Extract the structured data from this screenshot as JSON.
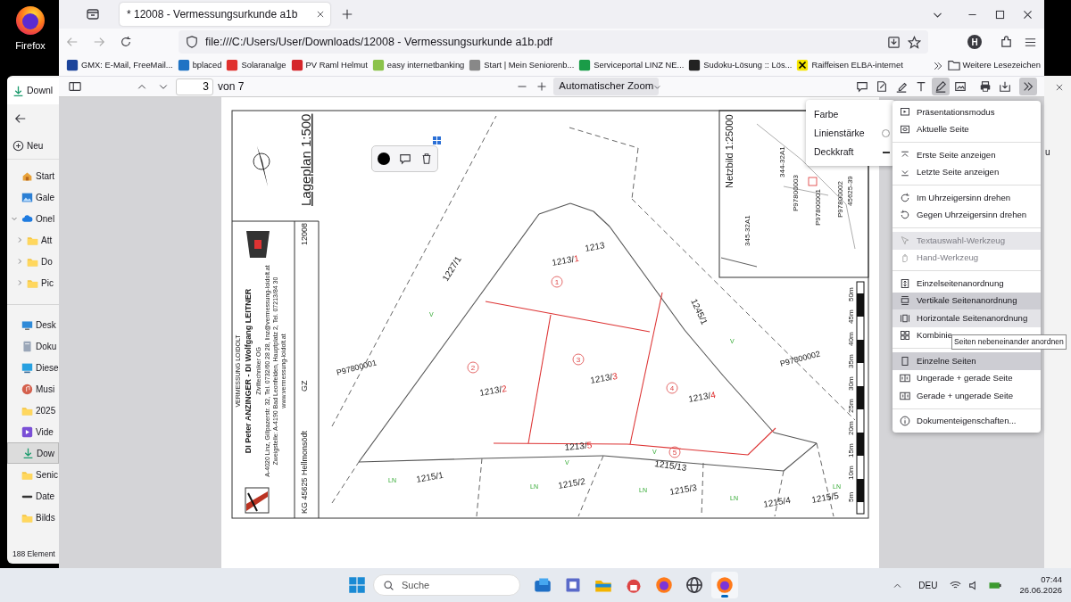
{
  "desktop": {
    "icons": [
      {
        "label": "Firefox"
      }
    ]
  },
  "explorer": {
    "tab": "Downl",
    "new_button": "Neu",
    "nav": [
      {
        "label": "Start",
        "kind": "home",
        "selected": false
      },
      {
        "label": "Gale",
        "kind": "gallery",
        "selected": false
      },
      {
        "label": "Onel",
        "kind": "cloud",
        "selected": false,
        "expanded": true,
        "children": [
          {
            "label": "Att",
            "kind": "folder",
            "selected": false,
            "expanded": false
          },
          {
            "label": "Do",
            "kind": "folder",
            "selected": false,
            "expanded": false
          },
          {
            "label": "Pic",
            "kind": "folder",
            "selected": false,
            "expanded": false
          }
        ]
      },
      {
        "label": "Desk",
        "kind": "desktop",
        "selected": false,
        "group_start": true
      },
      {
        "label": "Doku",
        "kind": "document",
        "selected": false
      },
      {
        "label": "Diese",
        "kind": "pc",
        "selected": false
      },
      {
        "label": "Musi",
        "kind": "music",
        "selected": false
      },
      {
        "label": "2025",
        "kind": "folder",
        "selected": false
      },
      {
        "label": "Vide",
        "kind": "video",
        "selected": false
      },
      {
        "label": "Dow",
        "kind": "download",
        "selected": true
      },
      {
        "label": "Senic",
        "kind": "folder",
        "selected": false
      },
      {
        "label": "Date",
        "kind": "drive",
        "selected": false
      },
      {
        "label": "Bilds",
        "kind": "folder",
        "selected": false
      }
    ],
    "status": "188 Element"
  },
  "firefox": {
    "tab": {
      "title": "* 12008 - Vermessungsurkunde a1b"
    },
    "url": "file:///C:/Users/User/Downloads/12008 - Vermessungsurkunde a1b.pdf",
    "account_initial": "H",
    "bookmarks": [
      {
        "label": "GMX: E-Mail, FreeMail...",
        "kind": "gmx"
      },
      {
        "label": "bplaced",
        "kind": "bplaced"
      },
      {
        "label": "Solaranalge",
        "kind": "solar"
      },
      {
        "label": "PV Raml Helmut",
        "kind": "pv"
      },
      {
        "label": "easy internetbanking",
        "kind": "bank"
      },
      {
        "label": "Start | Mein Seniorenb...",
        "kind": "senior"
      },
      {
        "label": "Serviceportal LINZ NE...",
        "kind": "linz"
      },
      {
        "label": "Sudoku-Lösung :: Lös...",
        "kind": "sudoku"
      },
      {
        "label": "Raiffeisen ELBA-internet",
        "kind": "raiffeisen"
      }
    ],
    "more_bookmarks": "Weitere Lesezeichen"
  },
  "pdf_toolbar": {
    "page": "3",
    "page_count": "von 7",
    "zoom": "Automatischer Zoom",
    "tools": [
      {
        "kind": "comment",
        "selected": false
      },
      {
        "kind": "signature",
        "selected": false
      },
      {
        "kind": "highlight",
        "selected": false
      },
      {
        "kind": "text",
        "selected": false
      },
      {
        "kind": "draw",
        "selected": true
      },
      {
        "kind": "image",
        "selected": false
      },
      {
        "kind": "print",
        "selected": false
      },
      {
        "kind": "save",
        "selected": false
      },
      {
        "kind": "more",
        "selected": true
      }
    ]
  },
  "plan": {
    "title": "Lageplan 1:500",
    "gz_label": "GZ",
    "gz": "12008",
    "kg": "KG 45625 Hellmonsödt",
    "firm": [
      "VERMESSUNG LOIDOLT",
      "DI Peter ANZINGER - DI Wolfgang LEITNER",
      "Ziviltechniker OG",
      "A-4020 Linz, Gillpazerstr. 32, Tel. 0732/60 28 28, linz@vermessung-loidolt.at",
      "Zweigstelle: A-4190 Bad Leonfelden, Hauptplatz 2, Tel. 07213/84 30",
      "www.vermessung-loidolt.at"
    ],
    "parcels": [
      {
        "number": "1227/1"
      },
      {
        "number": "1245/1"
      },
      {
        "number": "1213"
      },
      {
        "number": "1213/",
        "part": "1"
      },
      {
        "number": "1213/",
        "part": "2"
      },
      {
        "number": "1213/",
        "part": "3"
      },
      {
        "number": "1213/",
        "part": "4"
      },
      {
        "number": "1213/",
        "part": "5"
      },
      {
        "number": "1215/1"
      },
      {
        "number": "1215/13"
      },
      {
        "number": "1215/2"
      },
      {
        "number": "1215/3"
      },
      {
        "number": "1215/4"
      },
      {
        "number": "1215/5"
      }
    ],
    "points": [
      "P97800001",
      "P97800002"
    ],
    "lots": [
      "1",
      "2",
      "3",
      "4",
      "5"
    ],
    "usage": [
      "V",
      "V",
      "V",
      "V",
      "LN",
      "LN",
      "LN",
      "LN",
      "LN"
    ],
    "inset": {
      "title": "Netzbild 1:25000",
      "labels": [
        "344-32A1",
        "345-32A1",
        "P97800003",
        "P97800001",
        "P97800002",
        "45625-39"
      ]
    },
    "scale": [
      "50m",
      "45m",
      "40m",
      "35m",
      "30m",
      "25m",
      "20m",
      "15m",
      "10m",
      "5m"
    ]
  },
  "properties_popup": {
    "rows": [
      "Farbe",
      "Linienstärke",
      "Deckkraft"
    ]
  },
  "menu": {
    "groups": [
      [
        {
          "label": "Präsentationsmodus",
          "kind": "presentation",
          "selected": false,
          "disabled": false,
          "hovered": false
        },
        {
          "label": "Aktuelle Seite",
          "kind": "current",
          "selected": false,
          "disabled": false,
          "hovered": false
        }
      ],
      [
        {
          "label": "Erste Seite anzeigen",
          "kind": "first",
          "selected": false,
          "disabled": false,
          "hovered": false
        },
        {
          "label": "Letzte Seite anzeigen",
          "kind": "last",
          "selected": false,
          "disabled": false,
          "hovered": false
        }
      ],
      [
        {
          "label": "Im Uhrzeigersinn drehen",
          "kind": "cw",
          "selected": false,
          "disabled": false,
          "hovered": false
        },
        {
          "label": "Gegen Uhrzeigersinn drehen",
          "kind": "ccw",
          "selected": false,
          "disabled": false,
          "hovered": false
        }
      ],
      [
        {
          "label": "Textauswahl-Werkzeug",
          "kind": "cursor",
          "selected": true,
          "disabled": true,
          "hovered": false
        },
        {
          "label": "Hand-Werkzeug",
          "kind": "hand",
          "selected": false,
          "disabled": true,
          "hovered": false
        }
      ],
      [
        {
          "label": "Einzelseitenanordnung",
          "kind": "single_scroll",
          "selected": false,
          "disabled": false,
          "hovered": false
        },
        {
          "label": "Vertikale Seitenanordnung",
          "kind": "vertical",
          "selected": true,
          "disabled": false,
          "hovered": false
        },
        {
          "label": "Horizontale Seitenanordnung",
          "kind": "horizontal",
          "selected": false,
          "disabled": false,
          "hovered": true
        },
        {
          "label": "Kombinie",
          "kind": "wrapped",
          "selected": false,
          "disabled": false,
          "hovered": false
        }
      ],
      [
        {
          "label": "Einzelne Seiten",
          "kind": "single",
          "selected": true,
          "disabled": false,
          "hovered": false
        },
        {
          "label": "Ungerade + gerade Seite",
          "kind": "odd",
          "selected": false,
          "disabled": false,
          "hovered": false
        },
        {
          "label": "Gerade + ungerade Seite",
          "kind": "even",
          "selected": false,
          "disabled": false,
          "hovered": false
        }
      ],
      [
        {
          "label": "Dokumenteigenschaften...",
          "kind": "info",
          "selected": false,
          "disabled": false,
          "hovered": false
        }
      ]
    ]
  },
  "tooltip": "Seiten nebeneinander anordnen",
  "back_window": {
    "text": "u"
  },
  "taskbar": {
    "search": "Suche",
    "apps": [
      {
        "kind": "outlook",
        "active": false
      },
      {
        "kind": "word",
        "active": false
      },
      {
        "kind": "explorer",
        "active": false
      },
      {
        "kind": "phone",
        "active": false
      },
      {
        "kind": "firefox",
        "active": false
      },
      {
        "kind": "globe",
        "active": false
      },
      {
        "kind": "firefox",
        "active": true
      }
    ],
    "language": "DEU",
    "time": "07:44",
    "date": "26.06.2026"
  }
}
